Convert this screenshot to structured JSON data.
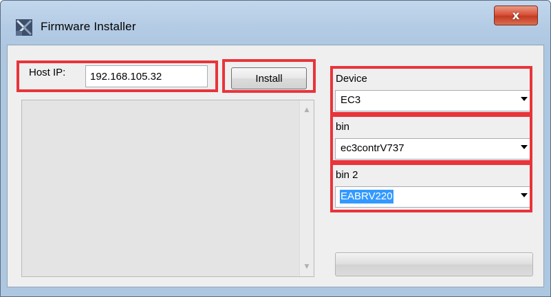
{
  "window": {
    "title": "Firmware Installer",
    "close_label": "x"
  },
  "host": {
    "label": "Host IP:",
    "value": "192.168.105.32"
  },
  "install_button": {
    "label": "Install"
  },
  "device": {
    "label": "Device",
    "selected": "EC3"
  },
  "bin": {
    "label": "bin",
    "selected": "ec3contrV737"
  },
  "bin2": {
    "label": "bin 2",
    "selected": "EABRV220"
  },
  "progress": {
    "fraction": 0
  },
  "colors": {
    "highlight": "#e8343a",
    "selection": "#3399ff",
    "titlebar": "#b3cbe4"
  }
}
